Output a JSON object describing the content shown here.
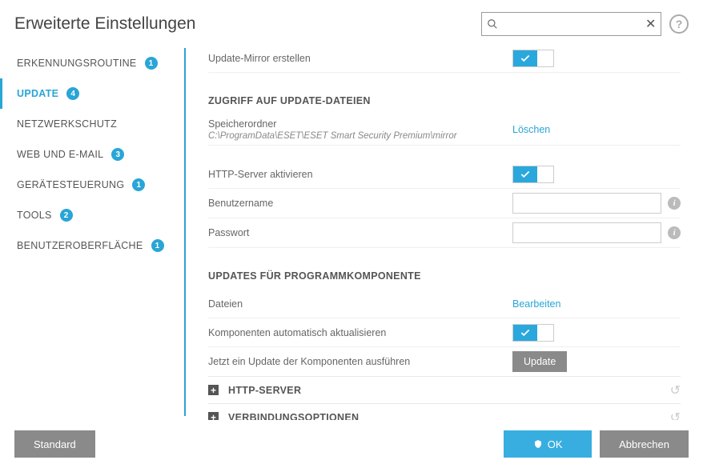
{
  "header": {
    "title": "Erweiterte Einstellungen",
    "search_placeholder": ""
  },
  "sidebar": {
    "items": [
      {
        "label": "ERKENNUNGSROUTINE",
        "badge": "1",
        "active": false
      },
      {
        "label": "UPDATE",
        "badge": "4",
        "active": true
      },
      {
        "label": "NETZWERKSCHUTZ",
        "badge": "",
        "active": false
      },
      {
        "label": "WEB UND E-MAIL",
        "badge": "3",
        "active": false
      },
      {
        "label": "GERÄTESTEUERUNG",
        "badge": "1",
        "active": false
      },
      {
        "label": "TOOLS",
        "badge": "2",
        "active": false
      },
      {
        "label": "BENUTZEROBERFLÄCHE",
        "badge": "1",
        "active": false
      }
    ]
  },
  "main": {
    "mirror": {
      "create_label": "Update-Mirror erstellen",
      "create_on": true
    },
    "access": {
      "title": "ZUGRIFF AUF UPDATE-DATEIEN",
      "storage_label": "Speicherordner",
      "storage_path": "C:\\ProgramData\\ESET\\ESET Smart Security Premium\\mirror",
      "delete_link": "Löschen",
      "http_enable_label": "HTTP-Server aktivieren",
      "http_enable_on": true,
      "username_label": "Benutzername",
      "username_value": "",
      "password_label": "Passwort",
      "password_value": ""
    },
    "components": {
      "title": "UPDATES FÜR PROGRAMMKOMPONENTE",
      "files_label": "Dateien",
      "files_link": "Bearbeiten",
      "auto_label": "Komponenten automatisch aktualisieren",
      "auto_on": true,
      "now_label": "Jetzt ein Update der Komponenten ausführen",
      "now_button": "Update"
    },
    "accordions": [
      {
        "label": "HTTP-SERVER"
      },
      {
        "label": "VERBINDUNGSOPTIONEN"
      }
    ]
  },
  "footer": {
    "default": "Standard",
    "ok": "OK",
    "cancel": "Abbrechen"
  }
}
